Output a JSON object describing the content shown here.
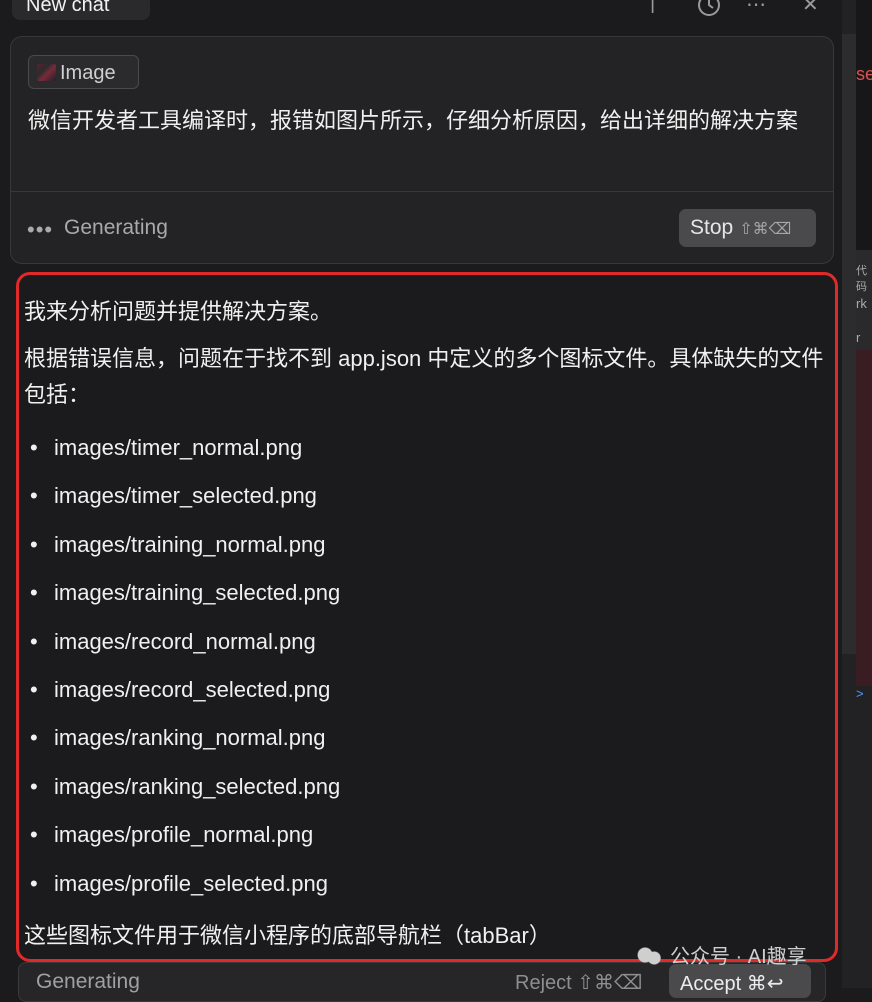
{
  "header": {
    "tab_title": "New chat"
  },
  "prompt": {
    "attachment_label": "Image",
    "text": "微信开发者工具编译时，报错如图片所示，仔细分析原因，给出详细的解决方案",
    "status_dots": "•••",
    "status": "Generating",
    "stop_label": "Stop",
    "stop_shortcut": "⇧⌘⌫"
  },
  "response": {
    "intro": "我来分析问题并提供解决方案。",
    "paragraph": "根据错误信息，问题在于找不到 app.json 中定义的多个图标文件。具体缺失的文件包括：",
    "files": [
      "images/timer_normal.png",
      "images/timer_selected.png",
      "images/training_normal.png",
      "images/training_selected.png",
      "images/record_normal.png",
      "images/record_selected.png",
      "images/ranking_normal.png",
      "images/ranking_selected.png",
      "images/profile_normal.png",
      "images/profile_selected.png"
    ],
    "closing": "这些图标文件用于微信小程序的底部导航栏（tabBar）"
  },
  "bottom_bar": {
    "status": "Generating",
    "reject_label": "Reject ⇧⌘⌫",
    "accept_label": "Accept ⌘↩"
  },
  "watermark": "公众号 · AI趣享",
  "side_fragments": {
    "a": "se",
    "b": "代码",
    "c": "rk",
    "d": "r",
    "e": ">"
  }
}
